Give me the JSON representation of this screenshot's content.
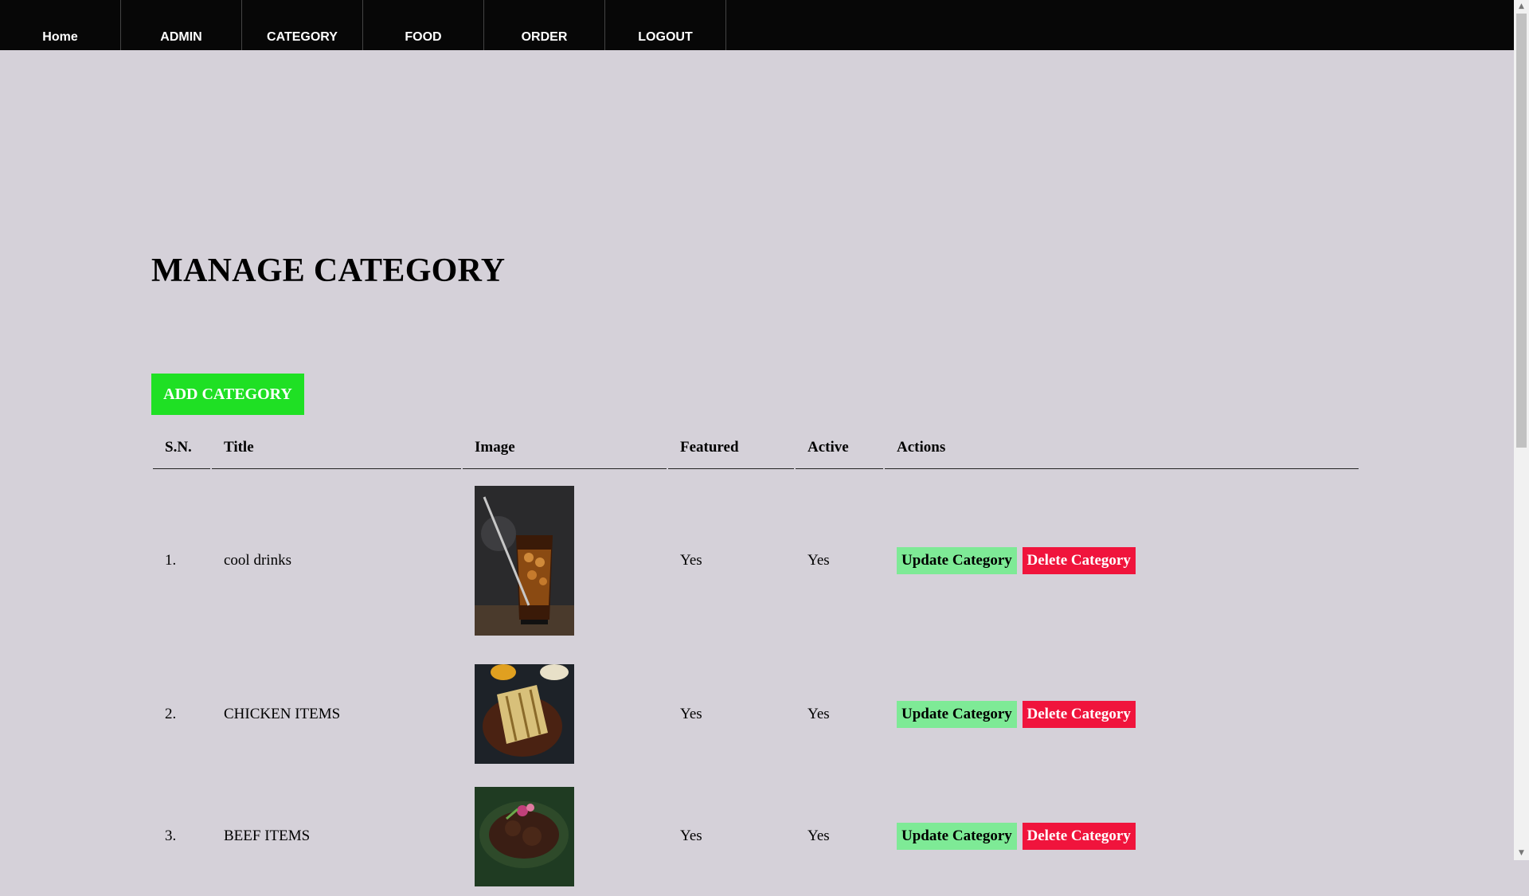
{
  "nav": {
    "items": [
      {
        "label": "Home"
      },
      {
        "label": "ADMIN"
      },
      {
        "label": "CATEGORY"
      },
      {
        "label": "FOOD"
      },
      {
        "label": "ORDER"
      },
      {
        "label": "LOGOUT"
      }
    ]
  },
  "page": {
    "title": "MANAGE CATEGORY",
    "add_button": "ADD CATEGORY"
  },
  "table": {
    "headers": [
      "S.N.",
      "Title",
      "Image",
      "Featured",
      "Active",
      "Actions"
    ],
    "rows": [
      {
        "sn": "1.",
        "title": "cool drinks",
        "featured": "Yes",
        "active": "Yes",
        "update": "Update Category",
        "delete": "Delete Category"
      },
      {
        "sn": "2.",
        "title": "CHICKEN ITEMS",
        "featured": "Yes",
        "active": "Yes",
        "update": "Update Category",
        "delete": "Delete Category"
      },
      {
        "sn": "3.",
        "title": "BEEF ITEMS",
        "featured": "Yes",
        "active": "Yes",
        "update": "Update Category",
        "delete": "Delete Category"
      }
    ]
  },
  "colors": {
    "navbar": "#070707",
    "background": "#d5d1d9",
    "add_button": "#1fe024",
    "update_button": "#7eea96",
    "delete_button": "#f0143c"
  }
}
